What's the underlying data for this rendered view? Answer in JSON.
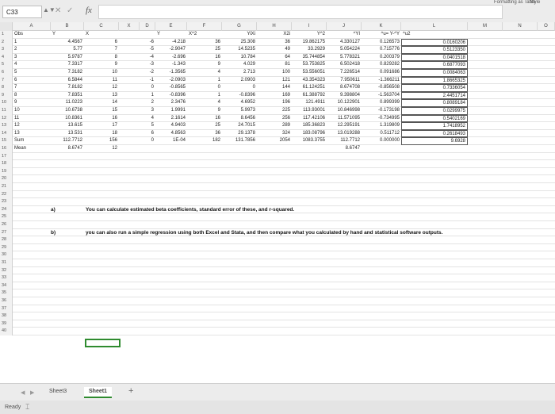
{
  "toolbar": {
    "name_box": "C33",
    "fx_label": "fx",
    "formula": "",
    "ribbon_format_table": "Formatting as Table",
    "ribbon_styles": "Style"
  },
  "columns": [
    "A",
    "B",
    "C",
    "X",
    "D",
    "E",
    "F",
    "G",
    "H",
    "I",
    "J",
    "K",
    "L",
    "M",
    "N",
    "O"
  ],
  "row_numbers": [
    "1",
    "2",
    "3",
    "4",
    "5",
    "6",
    "7",
    "8",
    "9",
    "10",
    "11",
    "12",
    "13",
    "14",
    "15",
    "16",
    "17",
    "18",
    "19",
    "20",
    "21",
    "22",
    "23",
    "24",
    "25",
    "26",
    "27",
    "28",
    "29",
    "30",
    "31",
    "32",
    "33",
    "34",
    "35",
    "36",
    "37",
    "38",
    "39",
    "40"
  ],
  "headers": {
    "obs": "Obs",
    "y": "Y",
    "x": "X",
    "y2": "Y",
    "x2": "X^2",
    "yxi": "YiXi",
    "x2i": "X2i",
    "y_sq": "Y^2",
    "yhat": "^YI",
    "u": "^u= Y-^Y",
    "u2": "^u2"
  },
  "table": [
    {
      "obs": "1",
      "y": "4.4567",
      "x": "6",
      "d": "-6",
      "e": "-4.218",
      "f": "36",
      "g": "25.308",
      "h": "36",
      "i": "19.862175",
      "j": "4.330127",
      "k": "0.126573",
      "l": "0.0160206"
    },
    {
      "obs": "2",
      "y": "5.77",
      "x": "7",
      "d": "-5",
      "e": "-2.9047",
      "f": "25",
      "g": "14.5235",
      "h": "49",
      "i": "33.2929",
      "j": "5.054224",
      "k": "0.715776",
      "l": "0.5123350"
    },
    {
      "obs": "3",
      "y": "5.9787",
      "x": "8",
      "d": "-4",
      "e": "-2.696",
      "f": "16",
      "g": "10.784",
      "h": "64",
      "i": "35.744854",
      "j": "5.778321",
      "k": "0.200379",
      "l": "0.0401518"
    },
    {
      "obs": "4",
      "y": "7.3317",
      "x": "9",
      "d": "-3",
      "e": "-1.343",
      "f": "9",
      "g": "4.029",
      "h": "81",
      "i": "53.753825",
      "j": "6.502418",
      "k": "0.829282",
      "l": "0.6877093"
    },
    {
      "obs": "5",
      "y": "7.3182",
      "x": "10",
      "d": "-2",
      "e": "-1.3565",
      "f": "4",
      "g": "2.713",
      "h": "100",
      "i": "53.556051",
      "j": "7.226514",
      "k": "0.091686",
      "l": "0.0084063"
    },
    {
      "obs": "6",
      "y": "6.5844",
      "x": "11",
      "d": "-1",
      "e": "-2.0903",
      "f": "1",
      "g": "2.0903",
      "h": "121",
      "i": "43.354323",
      "j": "7.950611",
      "k": "-1.366211",
      "l": "1.8665325"
    },
    {
      "obs": "7",
      "y": "7.8182",
      "x": "12",
      "d": "0",
      "e": "-0.8565",
      "f": "0",
      "g": "0",
      "h": "144",
      "i": "61.124251",
      "j": "8.674708",
      "k": "-0.856508",
      "l": "0.7336054"
    },
    {
      "obs": "8",
      "y": "7.8351",
      "x": "13",
      "d": "1",
      "e": "-0.8396",
      "f": "1",
      "g": "-0.8396",
      "h": "169",
      "i": "61.388792",
      "j": "9.398804",
      "k": "-1.563704",
      "l": "2.4451714"
    },
    {
      "obs": "9",
      "y": "11.0223",
      "x": "14",
      "d": "2",
      "e": "2.3476",
      "f": "4",
      "g": "4.6952",
      "h": "196",
      "i": "121.4911",
      "j": "10.122901",
      "k": "0.899399",
      "l": "0.8089184"
    },
    {
      "obs": "10",
      "y": "10.6738",
      "x": "15",
      "d": "3",
      "e": "1.9991",
      "f": "9",
      "g": "5.9973",
      "h": "225",
      "i": "113.93001",
      "j": "10.846998",
      "k": "-0.173198",
      "l": "0.0299975"
    },
    {
      "obs": "11",
      "y": "10.8361",
      "x": "16",
      "d": "4",
      "e": "2.1614",
      "f": "16",
      "g": "8.6456",
      "h": "256",
      "i": "117.42106",
      "j": "11.571095",
      "k": "-0.734995",
      "l": "0.5402169"
    },
    {
      "obs": "12",
      "y": "13.615",
      "x": "17",
      "d": "5",
      "e": "4.9403",
      "f": "25",
      "g": "24.7015",
      "h": "289",
      "i": "185.36823",
      "j": "12.295191",
      "k": "1.319809",
      "l": "1.7418952"
    },
    {
      "obs": "13",
      "y": "13.531",
      "x": "18",
      "d": "6",
      "e": "4.8563",
      "f": "36",
      "g": "29.1378",
      "h": "324",
      "i": "183.08796",
      "j": "13.019288",
      "k": "0.511712",
      "l": "0.2618493"
    }
  ],
  "sum_row": {
    "label": "Sum",
    "y": "112.7712",
    "x": "156",
    "d": "0",
    "e": "1E-04",
    "f": "182",
    "g": "131.7856",
    "h": "2054",
    "i": "1083.3755",
    "j": "112.7712",
    "k": "0.000000",
    "l": "9.6928"
  },
  "mean_row": {
    "label": "Mean",
    "y": "8.6747",
    "x": "12",
    "j": "8.6747"
  },
  "notes": {
    "a_label": "a)",
    "a_text": "You can calculate estimated beta coefficients, standard error of these, and r-squared.",
    "b_label": "b)",
    "b_text": "you can also run a simple regression using both Excel and Stata, and then compare what you calculated by hand and statistical software outputs."
  },
  "tabs": {
    "sheet3": "Sheet3",
    "sheet1": "Sheet1",
    "add": "+"
  },
  "status": {
    "ready": "Ready"
  }
}
